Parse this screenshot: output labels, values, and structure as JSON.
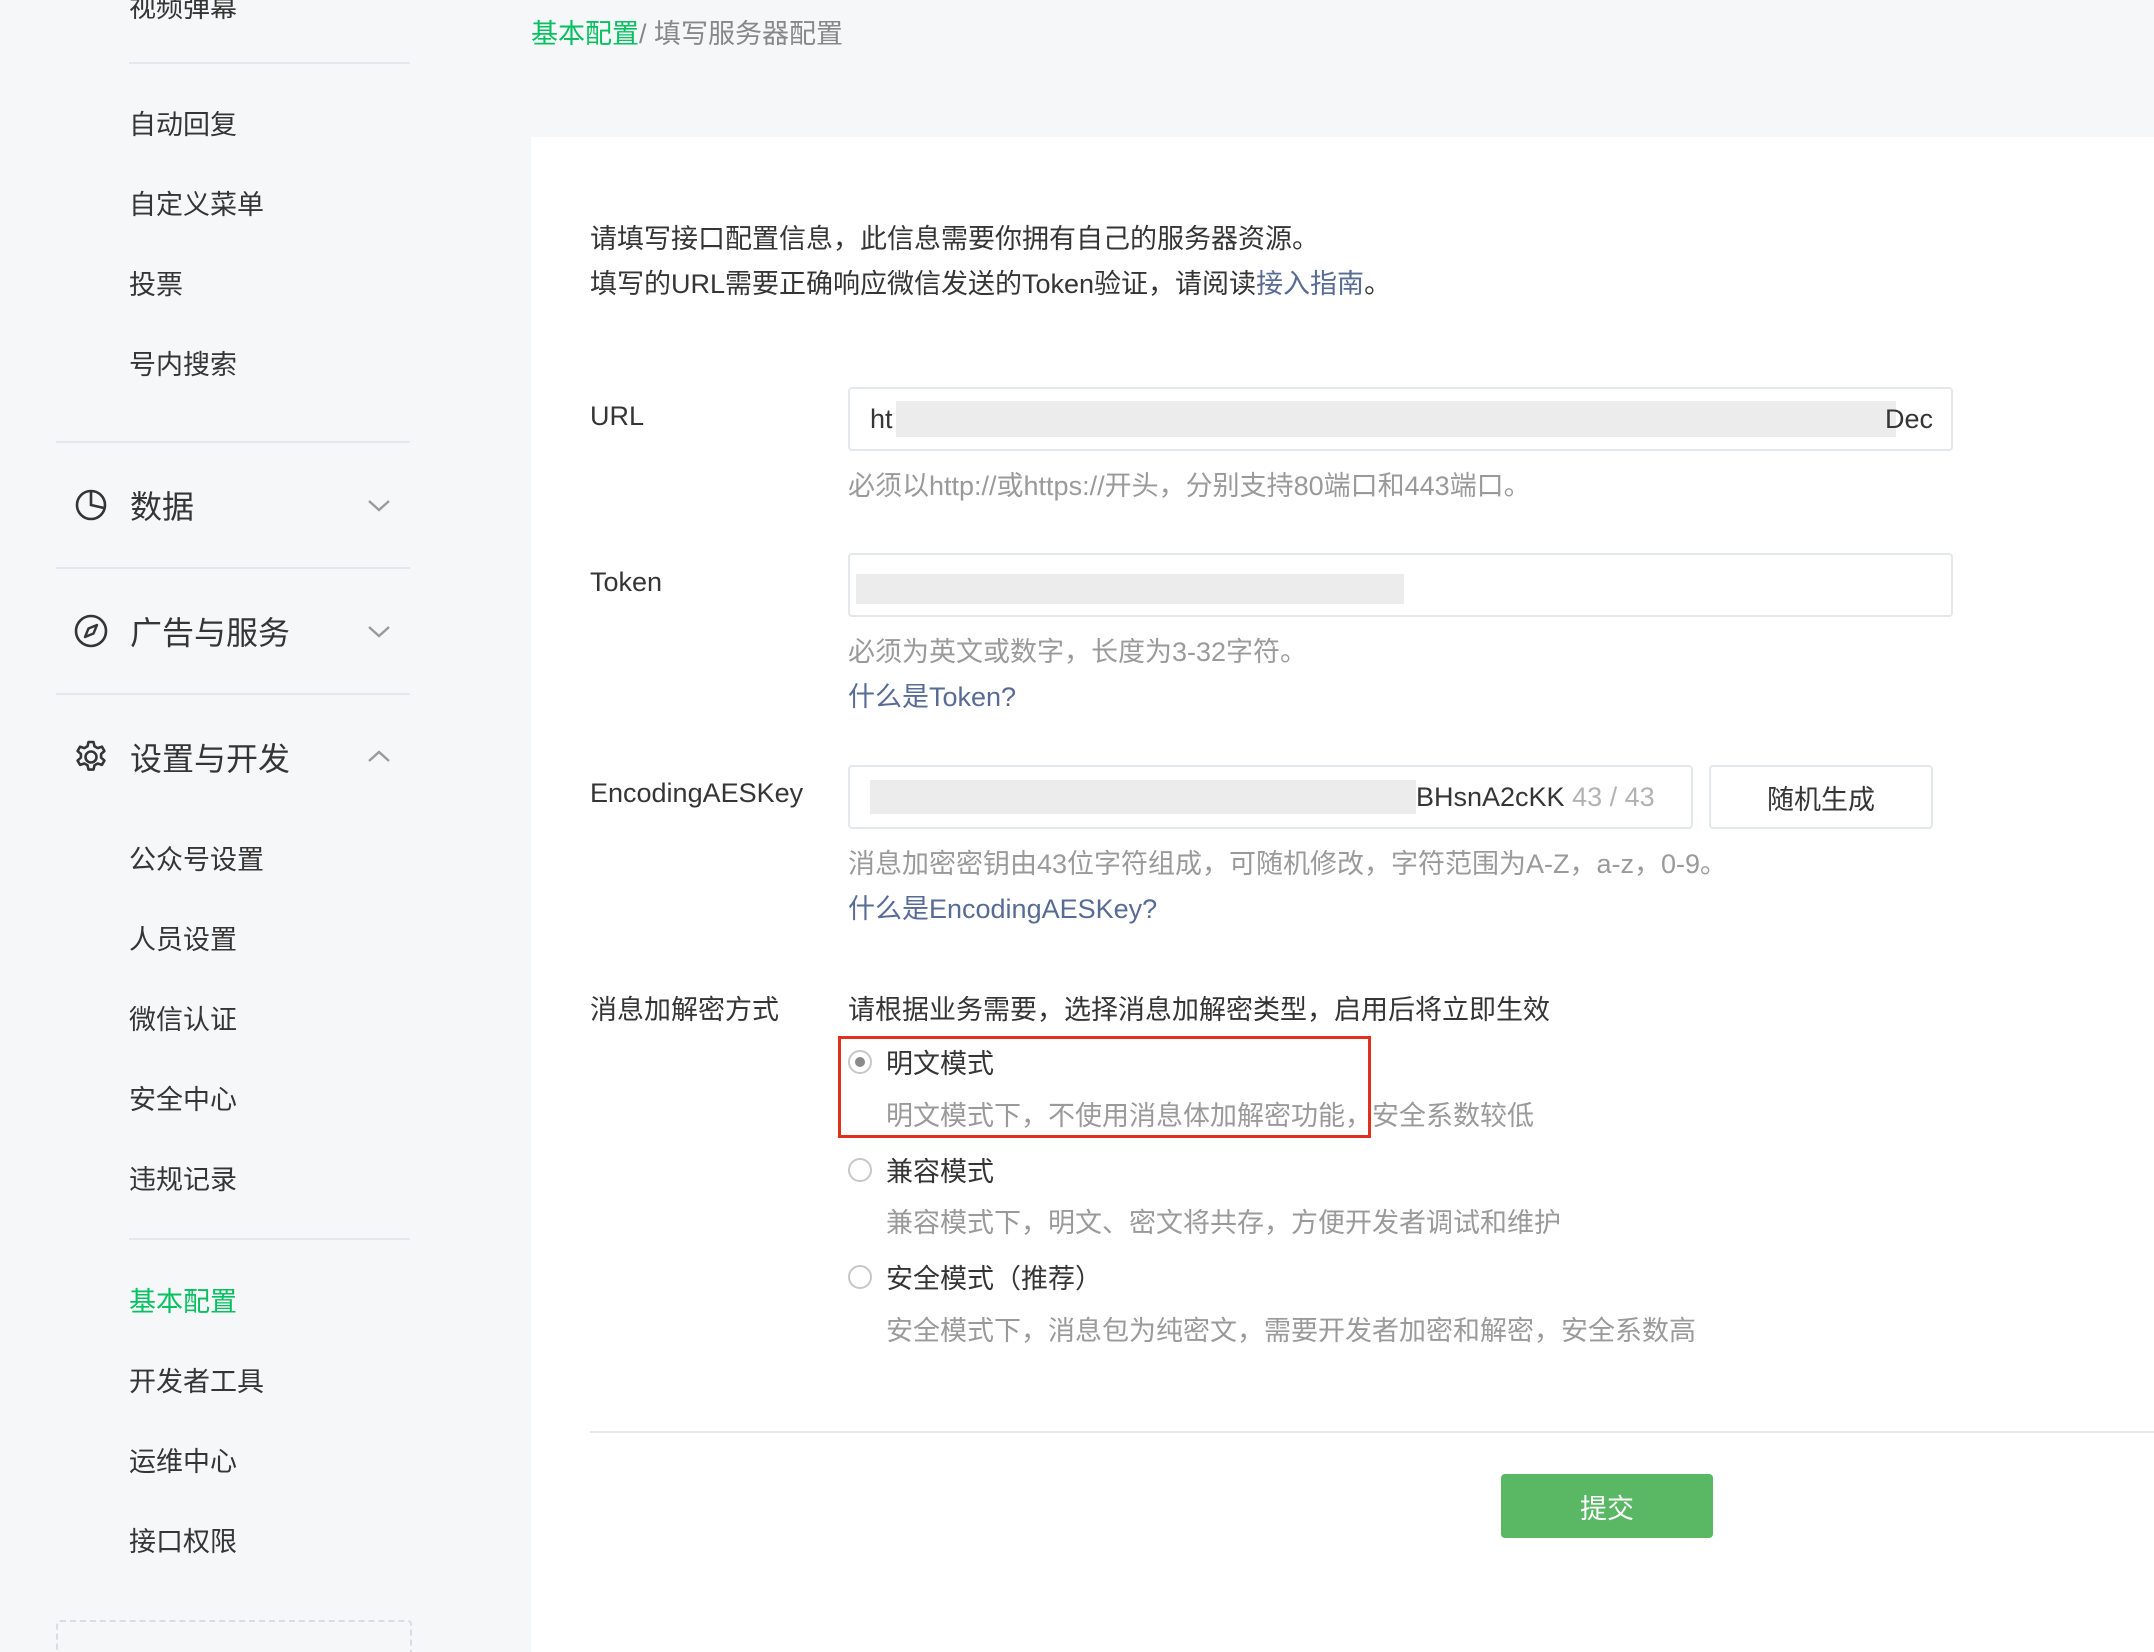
{
  "sidebar": {
    "top_partial_label": "视频弹幕",
    "group_items_a": [
      "自动回复",
      "自定义菜单",
      "投票",
      "号内搜索"
    ],
    "groups": [
      {
        "label": "数据",
        "icon": "pie-chart-icon",
        "expanded": false
      },
      {
        "label": "广告与服务",
        "icon": "compass-icon",
        "expanded": false
      },
      {
        "label": "设置与开发",
        "icon": "gear-icon",
        "expanded": true
      }
    ],
    "settings_items": [
      "公众号设置",
      "人员设置",
      "微信认证",
      "安全中心",
      "违规记录"
    ],
    "dev_items": [
      "基本配置",
      "开发者工具",
      "运维中心",
      "接口权限"
    ],
    "active_item": "基本配置"
  },
  "breadcrumb": {
    "link": "基本配置",
    "separator": "/",
    "current": " 填写服务器配置"
  },
  "intro": {
    "line1": "请填写接口配置信息，此信息需要你拥有自己的服务器资源。",
    "line2_prefix": "填写的URL需要正确响应微信发送的Token验证，请阅读",
    "line2_link": "接入指南",
    "line2_suffix": "。"
  },
  "form": {
    "url": {
      "label": "URL",
      "value_start": "ht",
      "value_end": "Dec",
      "hint": "必须以http://或https://开头，分别支持80端口和443端口。"
    },
    "token": {
      "label": "Token",
      "hint": "必须为英文或数字，长度为3-32字符。",
      "help_link": "什么是Token?"
    },
    "aeskey": {
      "label": "EncodingAESKey",
      "value_end": "BHsnA2cKK",
      "count": "43 / 43",
      "random_button": "随机生成",
      "hint": "消息加密密钥由43位字符组成，可随机修改，字符范围为A-Z，a-z，0-9。",
      "help_link": "什么是EncodingAESKey?"
    },
    "encrypt": {
      "label": "消息加解密方式",
      "intro": "请根据业务需要，选择消息加解密类型，启用后将立即生效",
      "options": [
        {
          "label": "明文模式",
          "desc": "明文模式下，不使用消息体加解密功能，安全系数较低",
          "checked": true
        },
        {
          "label": "兼容模式",
          "desc": "兼容模式下，明文、密文将共存，方便开发者调试和维护",
          "checked": false
        },
        {
          "label": "安全模式（推荐）",
          "desc": "安全模式下，消息包为纯密文，需要开发者加密和解密，安全系数高",
          "checked": false
        }
      ]
    },
    "submit": "提交"
  },
  "colors": {
    "accent_green": "#07c160",
    "link_blue": "#576b95",
    "submit_green": "#5ab865",
    "highlight_red": "#e0301e"
  }
}
